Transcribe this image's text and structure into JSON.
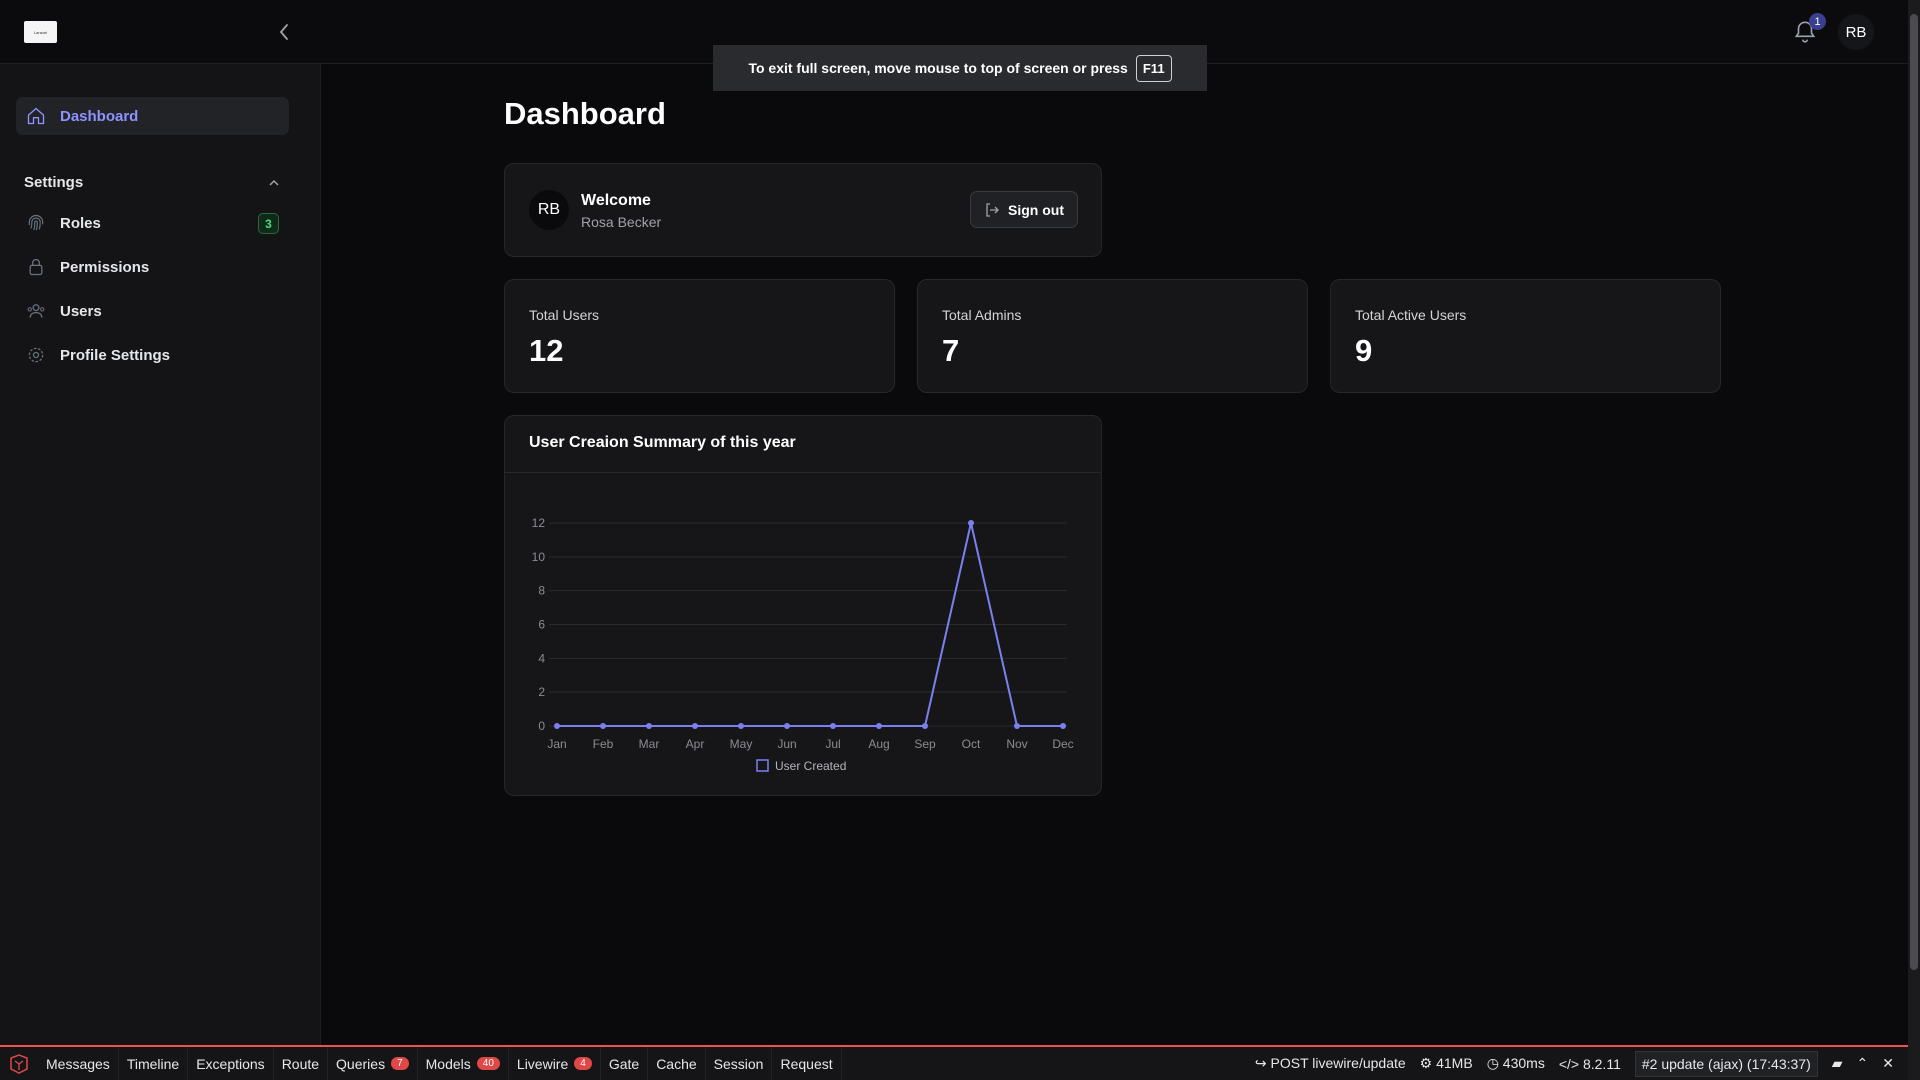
{
  "header": {
    "logo_text": "Laravel",
    "notification_count": "1",
    "avatar_initials": "RB"
  },
  "fullscreen_notice": {
    "text": "To exit full screen, move mouse to top of screen or press",
    "key": "F11"
  },
  "sidebar": {
    "dashboard_label": "Dashboard",
    "settings_group_label": "Settings",
    "items": [
      {
        "label": "Roles",
        "badge": "3",
        "icon": "fingerprint-icon"
      },
      {
        "label": "Permissions",
        "icon": "lock-icon"
      },
      {
        "label": "Users",
        "icon": "users-icon"
      },
      {
        "label": "Profile Settings",
        "icon": "gear-icon"
      }
    ]
  },
  "main": {
    "page_title": "Dashboard",
    "welcome": {
      "avatar_initials": "RB",
      "title": "Welcome",
      "name": "Rosa Becker",
      "signout_label": "Sign out"
    },
    "stats": [
      {
        "label": "Total Users",
        "value": "12"
      },
      {
        "label": "Total Admins",
        "value": "7"
      },
      {
        "label": "Total Active Users",
        "value": "9"
      }
    ],
    "chart_card_title": "User Creaion Summary of this year"
  },
  "chart_data": {
    "type": "line",
    "categories": [
      "Jan",
      "Feb",
      "Mar",
      "Apr",
      "May",
      "Jun",
      "Jul",
      "Aug",
      "Sep",
      "Oct",
      "Nov",
      "Dec"
    ],
    "series": [
      {
        "name": "User Created",
        "values": [
          0,
          0,
          0,
          0,
          0,
          0,
          0,
          0,
          0,
          12,
          0,
          0
        ],
        "color": "#7b80f0"
      }
    ],
    "yticks": [
      "0",
      "2",
      "4",
      "6",
      "8",
      "10",
      "12"
    ],
    "ylim": [
      0,
      12
    ],
    "grid": true,
    "legend_position": "bottom"
  },
  "debugbar": {
    "tabs": [
      {
        "label": "Messages"
      },
      {
        "label": "Timeline"
      },
      {
        "label": "Exceptions"
      },
      {
        "label": "Route"
      },
      {
        "label": "Queries",
        "badge": "7"
      },
      {
        "label": "Models",
        "badge": "40"
      },
      {
        "label": "Livewire",
        "badge": "4"
      },
      {
        "label": "Gate"
      },
      {
        "label": "Cache"
      },
      {
        "label": "Session"
      },
      {
        "label": "Request"
      }
    ],
    "request": "POST livewire/update",
    "memory": "41MB",
    "time": "430ms",
    "php_version": "8.2.11",
    "request_select": "#2 update (ajax) (17:43:37)",
    "accent_color": "#f05252"
  }
}
